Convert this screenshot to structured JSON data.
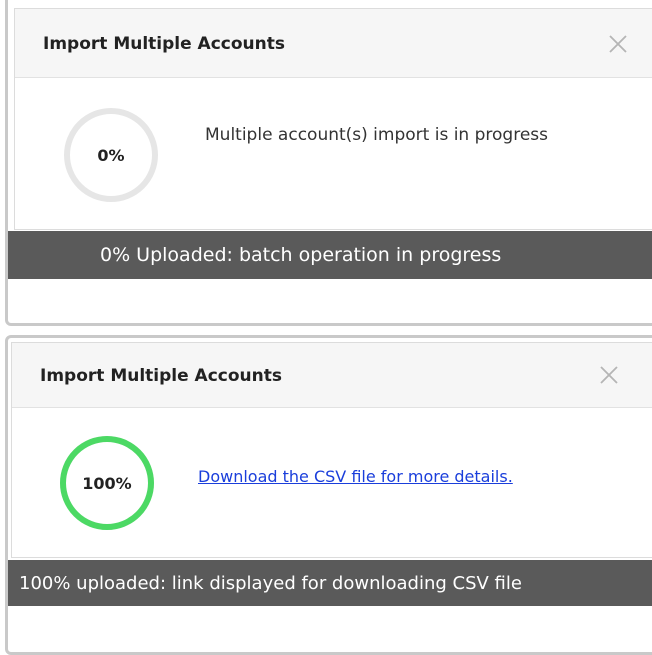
{
  "panels": [
    {
      "title": "Import Multiple Accounts",
      "close_icon": "close-icon",
      "progress": {
        "percent_label": "0%",
        "value": 0,
        "ring_color": "#e6e6e6",
        "fill_color": "#4cd964"
      },
      "message": "Multiple account(s) import is in progress",
      "caption": "0% Uploaded: batch operation in progress"
    },
    {
      "title": "Import Multiple Accounts",
      "close_icon": "close-icon",
      "progress": {
        "percent_label": "100%",
        "value": 100,
        "ring_color": "#e6e6e6",
        "fill_color": "#4cd964"
      },
      "link_text": "Download the CSV file for more details.",
      "caption": "100% uploaded: link displayed for downloading CSV file"
    }
  ]
}
